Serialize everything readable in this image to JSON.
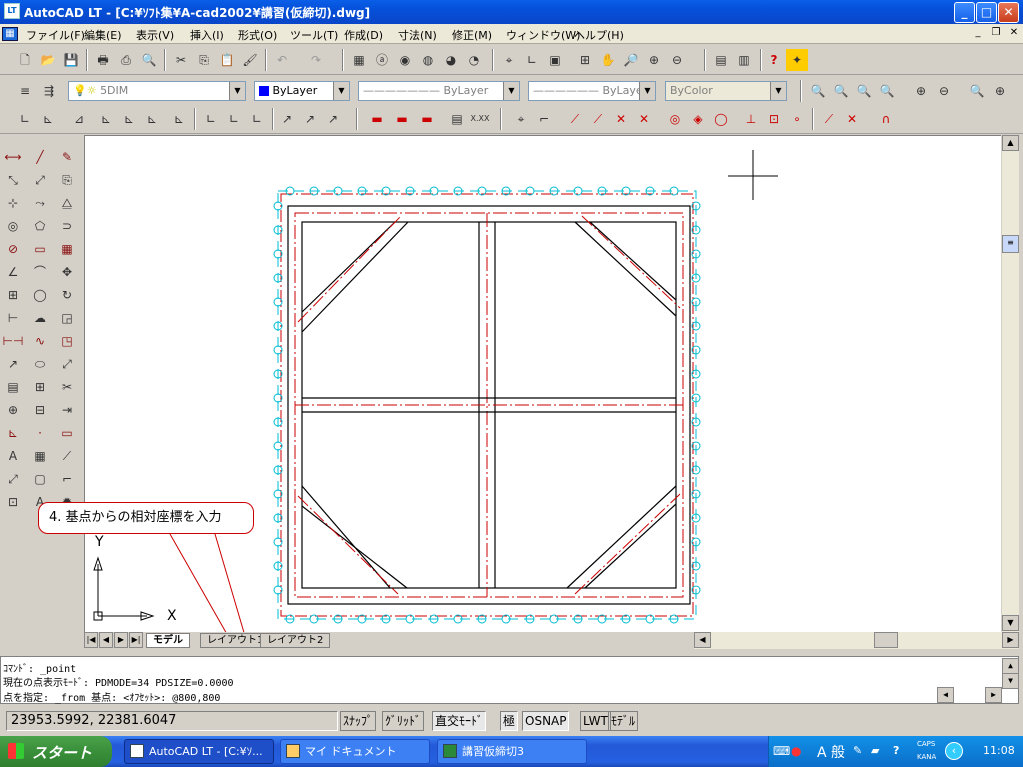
{
  "titlebar": {
    "title": "AutoCAD LT - [C:¥ｿﾌﾄ集¥A-cad2002¥講習(仮締切).dwg]",
    "app_icon": "LT",
    "minimize": "_",
    "maximize": "□",
    "close": "✕"
  },
  "menubar": {
    "items": [
      "ファイル(F)",
      "編集(E)",
      "表示(V)",
      "挿入(I)",
      "形式(O)",
      "ツール(T)",
      "作成(D)",
      "寸法(N)",
      "修正(M)",
      "ウィンドウ(W)",
      "ヘルプ(H)"
    ],
    "mdi_min": "_",
    "mdi_restore": "❐",
    "mdi_close": "✕"
  },
  "layer_toolbar": {
    "layer_name": "5DIM",
    "color": "ByLayer",
    "linetype": "ByLayer",
    "lineweight": "ByLayer",
    "plotstyle": "ByColor"
  },
  "callout": {
    "text": "4. 基点からの相対座標を入力"
  },
  "ucs": {
    "x": "X",
    "y": "Y"
  },
  "tabs": [
    "モデル",
    "レイアウト1",
    "レイアウト2"
  ],
  "command": {
    "line1": "ｺﾏﾝﾄﾞ: _point",
    "line2": "現在の点表示ﾓｰﾄﾞ:  PDMODE=34  PDSIZE=0.0000",
    "line3": "点を指定: _from 基点: <ｵﾌｾｯﾄ>: @800,800"
  },
  "status": {
    "coords": "23953.5992, 22381.6047",
    "buttons": [
      "ｽﾅｯﾌﾟ",
      "ｸﾞﾘｯﾄﾞ",
      "直交ﾓｰﾄﾞ",
      "極",
      "OSNAP",
      "LWT",
      "ﾓﾃﾞﾙ"
    ]
  },
  "taskbar": {
    "start": "スタート",
    "tasks": [
      "AutoCAD LT - [C:¥ｿ...",
      "マイ ドキュメント",
      "講習仮締切3"
    ],
    "tray_caps": "CAPS",
    "tray_kana": "KANA",
    "ime": "A 般",
    "clock": "11:08"
  },
  "colors": {
    "title_blue": "#0a5ee8",
    "draw_red": "#cc0000",
    "hatch_cyan": "#00bcd4",
    "taskbar_blue": "#245edb",
    "start_green": "#3a8f3a"
  }
}
